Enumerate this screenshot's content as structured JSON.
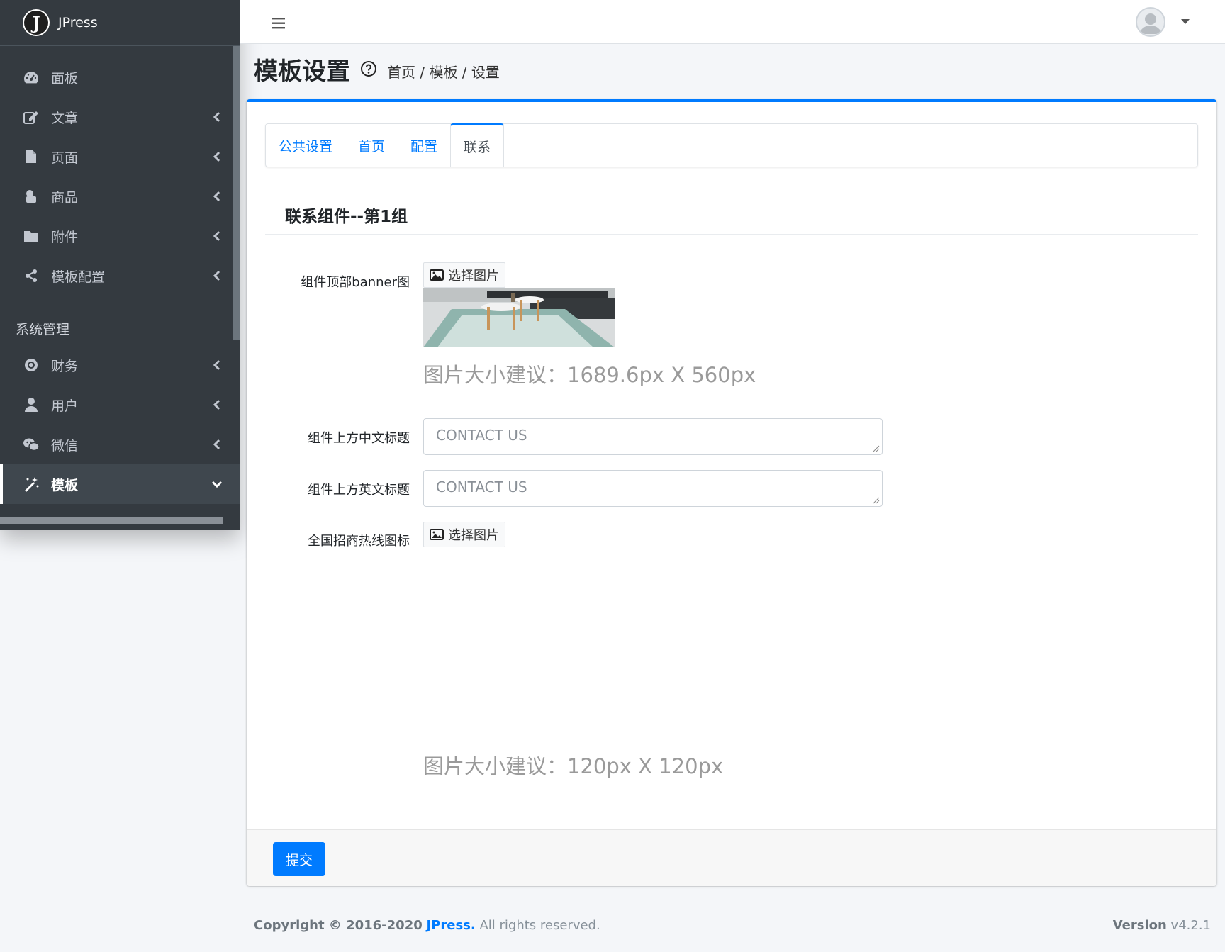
{
  "brand": {
    "name": "JPress",
    "logo_letter": "J"
  },
  "sidebar": {
    "items": [
      {
        "label": "面板",
        "icon": "dashboard-icon",
        "chevron": false
      },
      {
        "label": "文章",
        "icon": "edit-icon",
        "chevron": true
      },
      {
        "label": "页面",
        "icon": "file-icon",
        "chevron": true
      },
      {
        "label": "商品",
        "icon": "product-icon",
        "chevron": true
      },
      {
        "label": "附件",
        "icon": "folder-icon",
        "chevron": true
      },
      {
        "label": "模板配置",
        "icon": "share-icon",
        "chevron": true
      }
    ],
    "section_header": "系统管理",
    "system_items": [
      {
        "label": "财务",
        "icon": "finance-icon",
        "chevron": true
      },
      {
        "label": "用户",
        "icon": "user-icon",
        "chevron": true
      },
      {
        "label": "微信",
        "icon": "wechat-icon",
        "chevron": true
      },
      {
        "label": "模板",
        "icon": "magic-icon",
        "chevron": true,
        "active": true
      }
    ]
  },
  "header": {
    "title": "模板设置",
    "breadcrumb": "首页 / 模板 / 设置"
  },
  "tabs": [
    {
      "label": "公共设置",
      "active": false
    },
    {
      "label": "首页",
      "active": false
    },
    {
      "label": "配置",
      "active": false
    },
    {
      "label": "联系",
      "active": true
    }
  ],
  "section": {
    "title": "联系组件--第1组",
    "fields": {
      "banner": {
        "label": "组件顶部banner图",
        "button": "选择图片",
        "hint": "图片大小建议：1689.6px X 560px"
      },
      "cn_title": {
        "label": "组件上方中文标题",
        "value": "CONTACT US"
      },
      "en_title": {
        "label": "组件上方英文标题",
        "value": "CONTACT US"
      },
      "hotline_icon": {
        "label": "全国招商热线图标",
        "button": "选择图片",
        "hint": "图片大小建议：120px X 120px"
      }
    }
  },
  "submit_label": "提交",
  "footer": {
    "copyright_prefix": "Copyright © 2016-2020",
    "copyright_brand": "JPress.",
    "copyright_suffix": "All rights reserved.",
    "version_label": "Version",
    "version_value": "v4.2.1"
  },
  "colors": {
    "primary": "#007bff",
    "sidebar_bg": "#343a40"
  }
}
